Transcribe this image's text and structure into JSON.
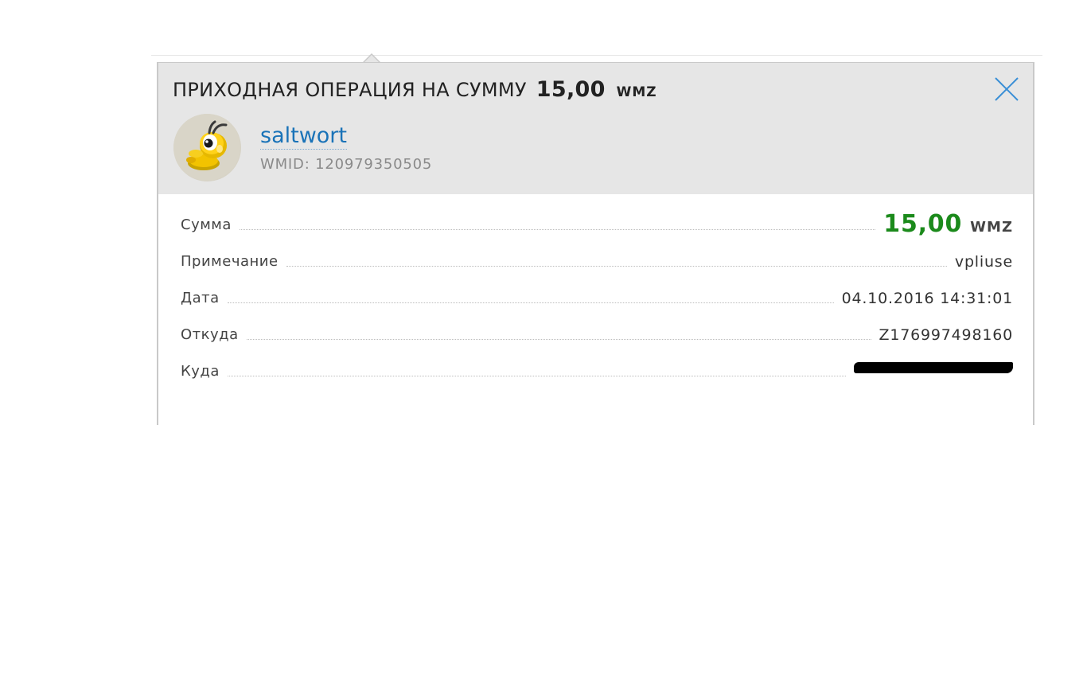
{
  "popup": {
    "title_prefix": "ПРИХОДНАЯ ОПЕРАЦИЯ НА СУММУ",
    "title_amount": "15,00",
    "title_currency": "WMZ"
  },
  "sender": {
    "username": "saltwort",
    "wmid": "WMID: 120979350505"
  },
  "details": {
    "amount_label": "Сумма",
    "amount_value": "15,00",
    "amount_currency": "WMZ",
    "note_label": "Примечание",
    "note_value": "vpliuse",
    "date_label": "Дата",
    "date_value": "04.10.2016 14:31:01",
    "from_label": "Откуда",
    "from_value": "Z176997498160",
    "to_label": "Куда"
  },
  "colors": {
    "amount_green": "#1b8a1b",
    "link_blue": "#1a73b8",
    "header_gray": "#e6e6e6"
  },
  "icons": {
    "close": "close-icon",
    "avatar": "ant-mascot-icon"
  }
}
